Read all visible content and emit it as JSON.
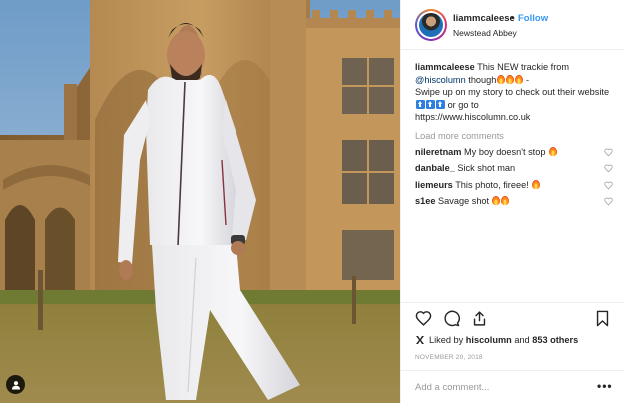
{
  "post": {
    "username": "liammcaleese",
    "follow_dot": "•",
    "follow_label": "Follow",
    "location": "Newstead Abbey",
    "caption": {
      "username": "liammcaleese",
      "text_1": "This NEW trackie from",
      "mention": "@hiscolumn",
      "text_2": "though",
      "text_3": "-",
      "text_4": "Swipe up on my story to check out their website",
      "text_5": "or go to",
      "text_6": "https://www.hiscolumn.co.uk"
    },
    "load_more": "Load more comments",
    "comments": [
      {
        "user": "nileretnam",
        "text": "My boy doesn't stop",
        "fires": 1
      },
      {
        "user": "danbale_",
        "text": "Sick shot man",
        "fires": 0
      },
      {
        "user": "liemeurs",
        "text": "This photo, fireee!",
        "fires": 1
      },
      {
        "user": "s1ee",
        "text": "Savage shot",
        "fires": 2
      }
    ],
    "likes": {
      "prefix": "Liked by",
      "by_user": "hiscolumn",
      "joiner": "and",
      "others": "853 others"
    },
    "date": "NOVEMBER 20, 2018",
    "add_comment_placeholder": "Add a comment...",
    "more_label": "•••"
  },
  "icons": {
    "like": "heart-icon",
    "comment": "comment-icon",
    "share": "share-icon",
    "save": "bookmark-icon",
    "user_tag": "person-icon"
  },
  "colors": {
    "accent": "#3897f0",
    "text": "#262626",
    "muted": "#999999",
    "border": "#efefef"
  }
}
